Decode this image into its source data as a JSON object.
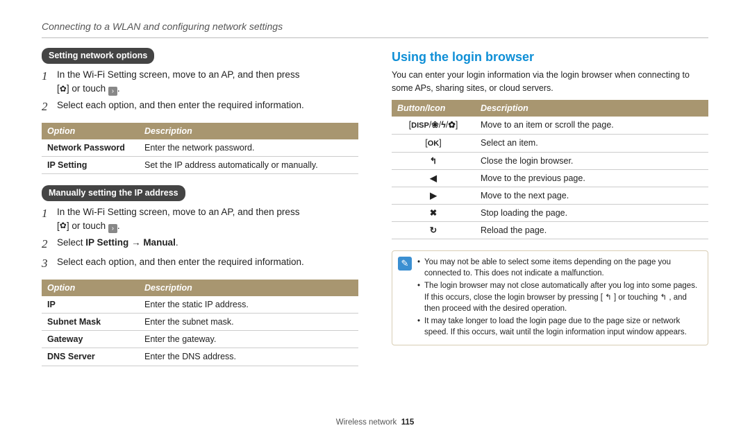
{
  "header": "Connecting to a WLAN and configuring network settings",
  "left": {
    "sec1": {
      "pill": "Setting network options",
      "steps": [
        {
          "num": "1",
          "text_a": "In the Wi-Fi Setting screen, move to an AP, and then press ",
          "text_b": "[",
          "text_c": "] or touch ",
          "text_d": "."
        },
        {
          "num": "2",
          "text": "Select each option, and then enter the required information."
        }
      ],
      "table": {
        "h1": "Option",
        "h2": "Description",
        "rows": [
          {
            "c1": "Network Password",
            "c2": "Enter the network password."
          },
          {
            "c1": "IP Setting",
            "c2": "Set the IP address automatically or manually."
          }
        ]
      }
    },
    "sec2": {
      "pill": "Manually setting the IP address",
      "steps": [
        {
          "num": "1",
          "text_a": "In the Wi-Fi Setting screen, move to an AP, and then press ",
          "text_b": "[",
          "text_c": "] or touch ",
          "text_d": "."
        },
        {
          "num": "2",
          "a": "Select ",
          "b": "IP Setting",
          "c": " → ",
          "d": "Manual",
          "e": "."
        },
        {
          "num": "3",
          "text": "Select each option, and then enter the required information."
        }
      ],
      "table": {
        "h1": "Option",
        "h2": "Description",
        "rows": [
          {
            "c1": "IP",
            "c2": "Enter the static IP address."
          },
          {
            "c1": "Subnet Mask",
            "c2": "Enter the subnet mask."
          },
          {
            "c1": "Gateway",
            "c2": "Enter the gateway."
          },
          {
            "c1": "DNS Server",
            "c2": "Enter the DNS address."
          }
        ]
      }
    }
  },
  "right": {
    "title": "Using the login browser",
    "desc": "You can enter your login information via the login browser when connecting to some APs, sharing sites, or cloud servers.",
    "table": {
      "h1": "Button/Icon",
      "h2": "Description",
      "rows": [
        {
          "icon": "disp",
          "c2": "Move to an item or scroll the page."
        },
        {
          "icon": "ok",
          "c2": "Select an item."
        },
        {
          "icon": "back",
          "c2": "Close the login browser."
        },
        {
          "icon": "left",
          "c2": "Move to the previous page."
        },
        {
          "icon": "right",
          "c2": "Move to the next page."
        },
        {
          "icon": "stop",
          "c2": "Stop loading the page."
        },
        {
          "icon": "reload",
          "c2": "Reload the page."
        }
      ]
    },
    "notes": [
      "You may not be able to select some items depending on the page you connected to. This does not indicate a malfunction.",
      "The login browser may not close automatically after you log into some pages. If this occurs, close the login browser by pressing [ ↰ ] or touching ↰ , and then proceed with the desired operation.",
      "It may take longer to load the login page due to the page size or network speed. If this occurs, wait until the login information input window appears."
    ]
  },
  "footer": {
    "section": "Wireless network",
    "page": "115"
  },
  "icons": {
    "flower": "✿",
    "chevron": "›",
    "disp_label": "DISP",
    "macro": "❀",
    "flash": "ϟ",
    "timer": "✿",
    "ok": "OK",
    "back": "↰",
    "left": "◀",
    "right": "▶",
    "stop": "✖",
    "reload": "↻",
    "note": "✎"
  }
}
